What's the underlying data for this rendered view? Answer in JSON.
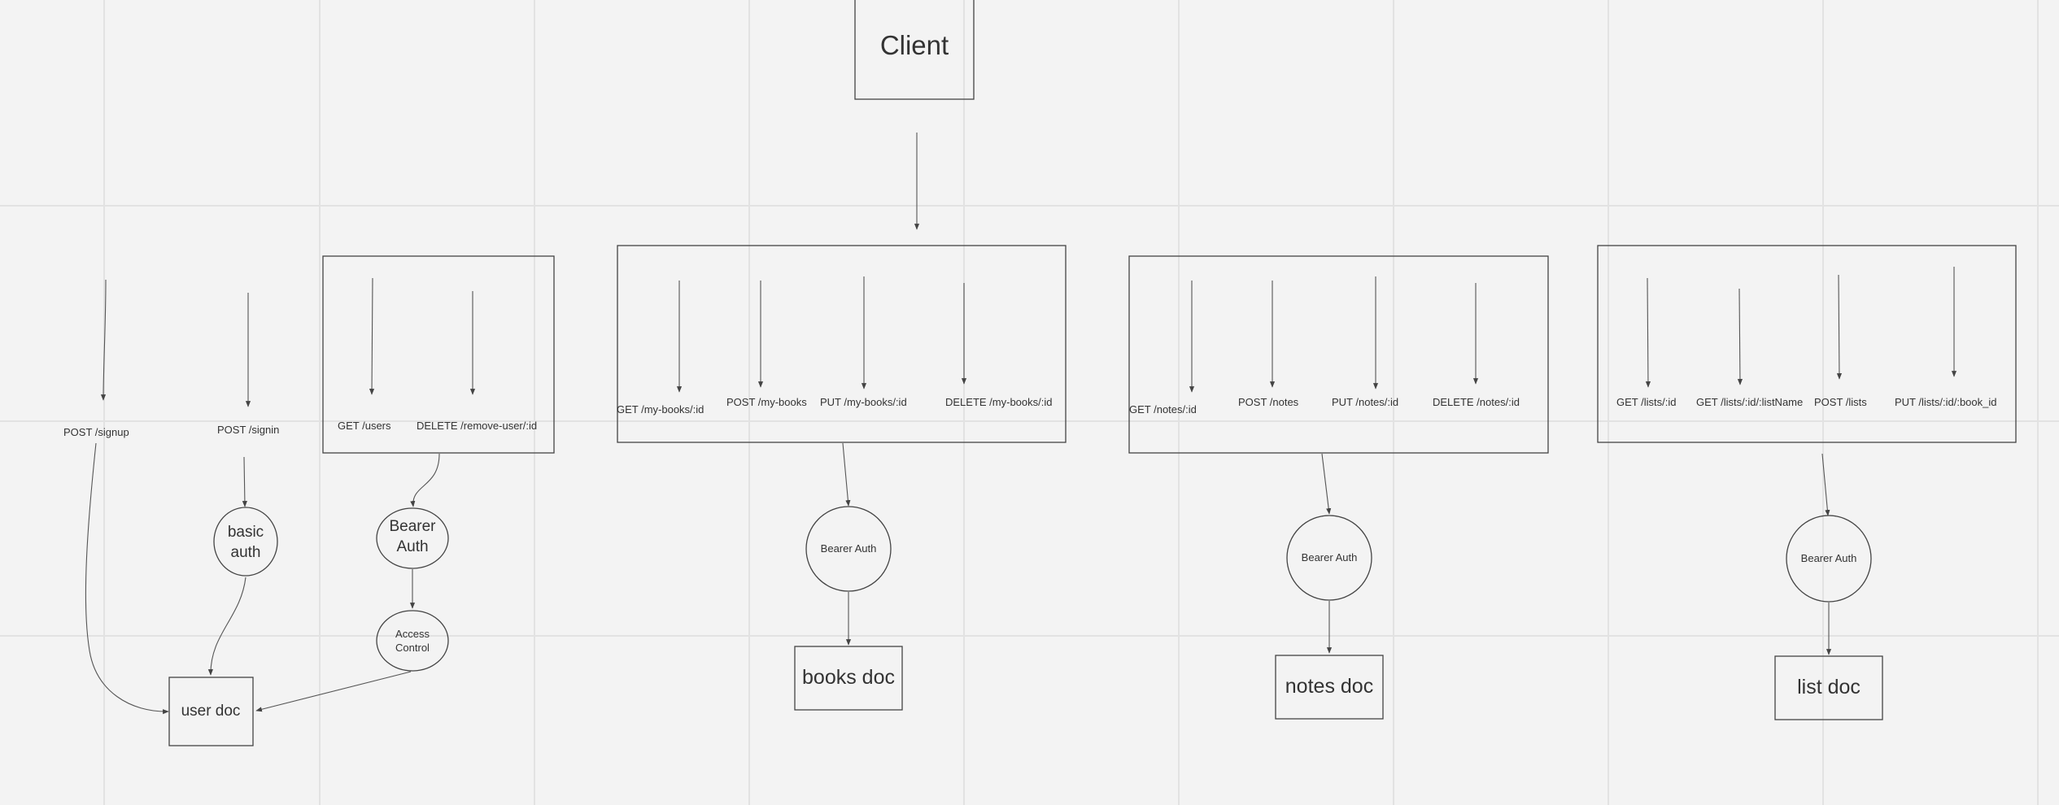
{
  "client": {
    "label": "Client"
  },
  "user_group": {
    "routes": [
      "POST /signup",
      "POST /signin",
      "GET /users",
      "DELETE /remove-user/:id"
    ],
    "basic_auth": [
      "basic",
      "auth"
    ],
    "bearer_auth": [
      "Bearer",
      "Auth"
    ],
    "access_control": [
      "Access",
      "Control"
    ],
    "doc": "user doc"
  },
  "books_group": {
    "routes": [
      "GET /my-books/:id",
      "POST /my-books",
      "PUT /my-books/:id",
      "DELETE /my-books/:id"
    ],
    "auth": "Bearer Auth",
    "doc": "books doc"
  },
  "notes_group": {
    "routes": [
      "GET /notes/:id",
      "POST /notes",
      "PUT /notes/:id",
      "DELETE /notes/:id"
    ],
    "auth": "Bearer Auth",
    "doc": "notes doc"
  },
  "lists_group": {
    "routes": [
      "GET /lists/:id",
      "GET /lists/:id/:listName",
      "POST /lists",
      "PUT /lists/:id/:book_id"
    ],
    "auth": "Bearer Auth",
    "doc": "list doc"
  }
}
